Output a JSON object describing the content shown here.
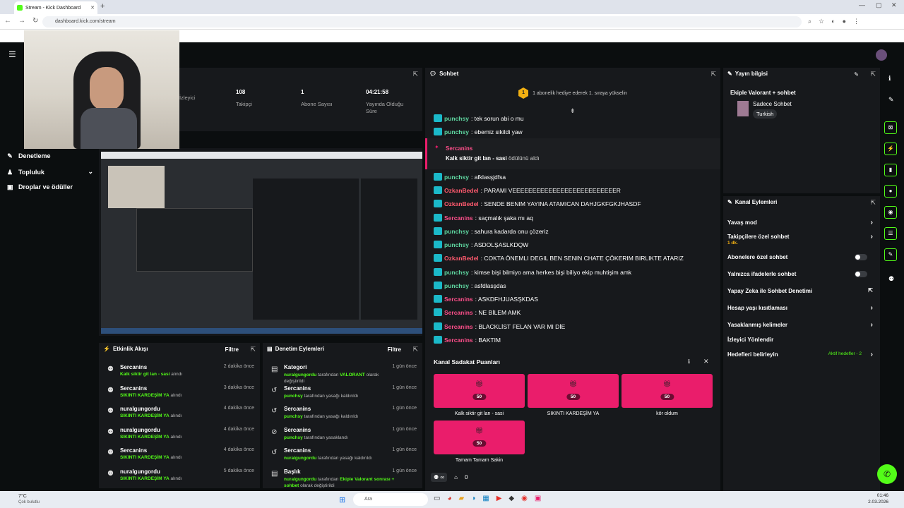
{
  "browser": {
    "tab_title": "Stream - Kick Dashboard",
    "url": "dashboard.kick.com/stream"
  },
  "stats": {
    "items": [
      {
        "value": "",
        "label": "İzleyici"
      },
      {
        "value": "108",
        "label": "Takipçi"
      },
      {
        "value": "1",
        "label": "Abone Sayısı"
      },
      {
        "value": "04:21:58",
        "label": "Yayında Olduğu Süre"
      }
    ]
  },
  "sidebar": {
    "items": [
      {
        "label": "Denetleme"
      },
      {
        "label": "Topluluk"
      },
      {
        "label": "Droplar ve ödüller"
      }
    ]
  },
  "activity": {
    "title": "Etkinlik Akışı",
    "filter": "Filtre",
    "rows": [
      {
        "name": "Sercanins",
        "sub": "Kalk siktir git lan - sasi",
        "suffix": "alındı",
        "time": "2 dakika önce"
      },
      {
        "name": "Sercanins",
        "sub": "SIKINTI KARDEŞİM YA",
        "suffix": "alındı",
        "time": "3 dakika önce"
      },
      {
        "name": "nuralgungordu",
        "sub": "SIKINTI KARDEŞİM YA",
        "suffix": "alındı",
        "time": "4 dakika önce"
      },
      {
        "name": "nuralgungordu",
        "sub": "SIKINTI KARDEŞİM YA",
        "suffix": "alındı",
        "time": "4 dakika önce"
      },
      {
        "name": "Sercanins",
        "sub": "SIKINTI KARDEŞİM YA",
        "suffix": "alındı",
        "time": "4 dakika önce"
      },
      {
        "name": "nuralgungordu",
        "sub": "SIKINTI KARDEŞİM YA",
        "suffix": "alındı",
        "time": "5 dakika önce"
      }
    ]
  },
  "moderation": {
    "title": "Denetim Eylemleri",
    "filter": "Filtre",
    "rows": [
      {
        "name": "Kategori",
        "by": "nuralgungordu",
        "mid": "tarafından",
        "hl": "VALORANT",
        "rest": "olarak değiştirildi",
        "time": "1 gün önce"
      },
      {
        "name": "Sercanins",
        "by": "punchsy",
        "mid": "tarafından yasağı kaldırıldı",
        "hl": "",
        "rest": "",
        "time": "1 gün önce"
      },
      {
        "name": "Sercanins",
        "by": "punchsy",
        "mid": "tarafından yasağı kaldırıldı",
        "hl": "",
        "rest": "",
        "time": "1 gün önce"
      },
      {
        "name": "Sercanins",
        "by": "punchsy",
        "mid": "tarafından yasaklandı",
        "hl": "",
        "rest": "",
        "time": "1 gün önce"
      },
      {
        "name": "Sercanins",
        "by": "nuralgungordu",
        "mid": "tarafından yasağı kaldırıldı",
        "hl": "",
        "rest": "",
        "time": "1 gün önce"
      },
      {
        "name": "Başlık",
        "by": "nuralgungordu",
        "mid": "tarafından",
        "hl": "Ekiple Valorant sonrası + sohbet",
        "rest": "olarak değiştirildi",
        "time": "1 gün önce"
      }
    ]
  },
  "chat": {
    "title": "Sohbet",
    "gift_banner": "1 abonelik hediye ederek 1. sıraya yükselin",
    "gift_num": "1",
    "reward": {
      "user": "Sercanins",
      "reward": "Kalk siktir git lan - sasi",
      "text": "ödülünü aldı"
    },
    "messages": [
      {
        "user": "punchsy",
        "color": "#5ed6a0",
        "text": ": tek sorun abi o mu"
      },
      {
        "user": "punchsy",
        "color": "#5ed6a0",
        "text": ": ebemiz sikildi yaw"
      },
      {
        "user": "punchsy",
        "color": "#5ed6a0",
        "text": ": afklasşjdfsa"
      },
      {
        "user": "OzkanBedel",
        "color": "#ff5a6e",
        "text": ": PARAMI VEEEEEEEEEEEEEEEEEEEEEEEEEER"
      },
      {
        "user": "OzkanBedel",
        "color": "#ff5a6e",
        "text": ": SENDE BENIM YAYINA ATAMICAN DAHJGKFGKJHASDF"
      },
      {
        "user": "Sercanins",
        "color": "#ff4f8b",
        "text": ": saçmalık şaka mı aq"
      },
      {
        "user": "punchsy",
        "color": "#5ed6a0",
        "text": ": sahura kadarda onu çözeriz"
      },
      {
        "user": "punchsy",
        "color": "#5ed6a0",
        "text": ": ASDOLŞASLKDQW"
      },
      {
        "user": "OzkanBedel",
        "color": "#ff5a6e",
        "text": ": COKTA ÖNEMLI DEGIL BEN SENIN CHATE ÇÖKERIM BIRLIKTE ATARIZ"
      },
      {
        "user": "punchsy",
        "color": "#5ed6a0",
        "text": ": kimse bişi bilmiyo ama herkes bişi biliyo ekip muhtişim amk"
      },
      {
        "user": "punchsy",
        "color": "#5ed6a0",
        "text": ": asfdlasşdas"
      },
      {
        "user": "Sercanins",
        "color": "#ff4f8b",
        "text": ": ASKDFHJUASŞKDAS"
      },
      {
        "user": "Sercanins",
        "color": "#ff4f8b",
        "text": ": NE BİLEM AMK"
      },
      {
        "user": "Sercanins",
        "color": "#ff4f8b",
        "text": ": BLACKLİST FELAN VAR MI DİE"
      },
      {
        "user": "Sercanins",
        "color": "#ff4f8b",
        "text": ": BAKTIM"
      }
    ]
  },
  "loyalty": {
    "title": "Kanal Sadakat Puanları",
    "cards": [
      {
        "label": "Kalk siktir git lan - sasi",
        "points": "50"
      },
      {
        "label": "SIKINTI KARDEŞİM YA",
        "points": "50"
      },
      {
        "label": "kör oldum",
        "points": "50"
      },
      {
        "label": "Tamam Tamam Sakin",
        "points": "50"
      }
    ],
    "count": "0"
  },
  "info": {
    "title": "Yayın bilgisi",
    "stream_title": "Ekiple Valorant + sohbet",
    "category": "Sadece Sohbet",
    "language": "Turkish"
  },
  "channel_actions": {
    "title": "Kanal Eylemleri",
    "items": [
      {
        "label": "Yavaş mod",
        "type": "chev"
      },
      {
        "label": "Takipçilere özel sohbet",
        "type": "chev",
        "sub": "1 dk."
      },
      {
        "label": "Abonelere özel sohbet",
        "type": "toggle"
      },
      {
        "label": "Yalnızca ifadelerle sohbet",
        "type": "toggle"
      },
      {
        "label": "Yapay Zeka ile Sohbet Denetimi",
        "type": "ext"
      },
      {
        "label": "Hesap yaşı kısıtlaması",
        "type": "chev"
      },
      {
        "label": "Yasaklanmış kelimeler",
        "type": "chev"
      },
      {
        "label": "İzleyici Yönlendir",
        "type": "none"
      },
      {
        "label": "Hedefleri belirleyin",
        "type": "chev",
        "sub": "Aktif hedefler - 2"
      }
    ]
  },
  "taskbar": {
    "search": "Ara",
    "weather": "7°C",
    "weather_sub": "Çok bulutlu",
    "time": "01:46",
    "date": "2.03.2026"
  }
}
